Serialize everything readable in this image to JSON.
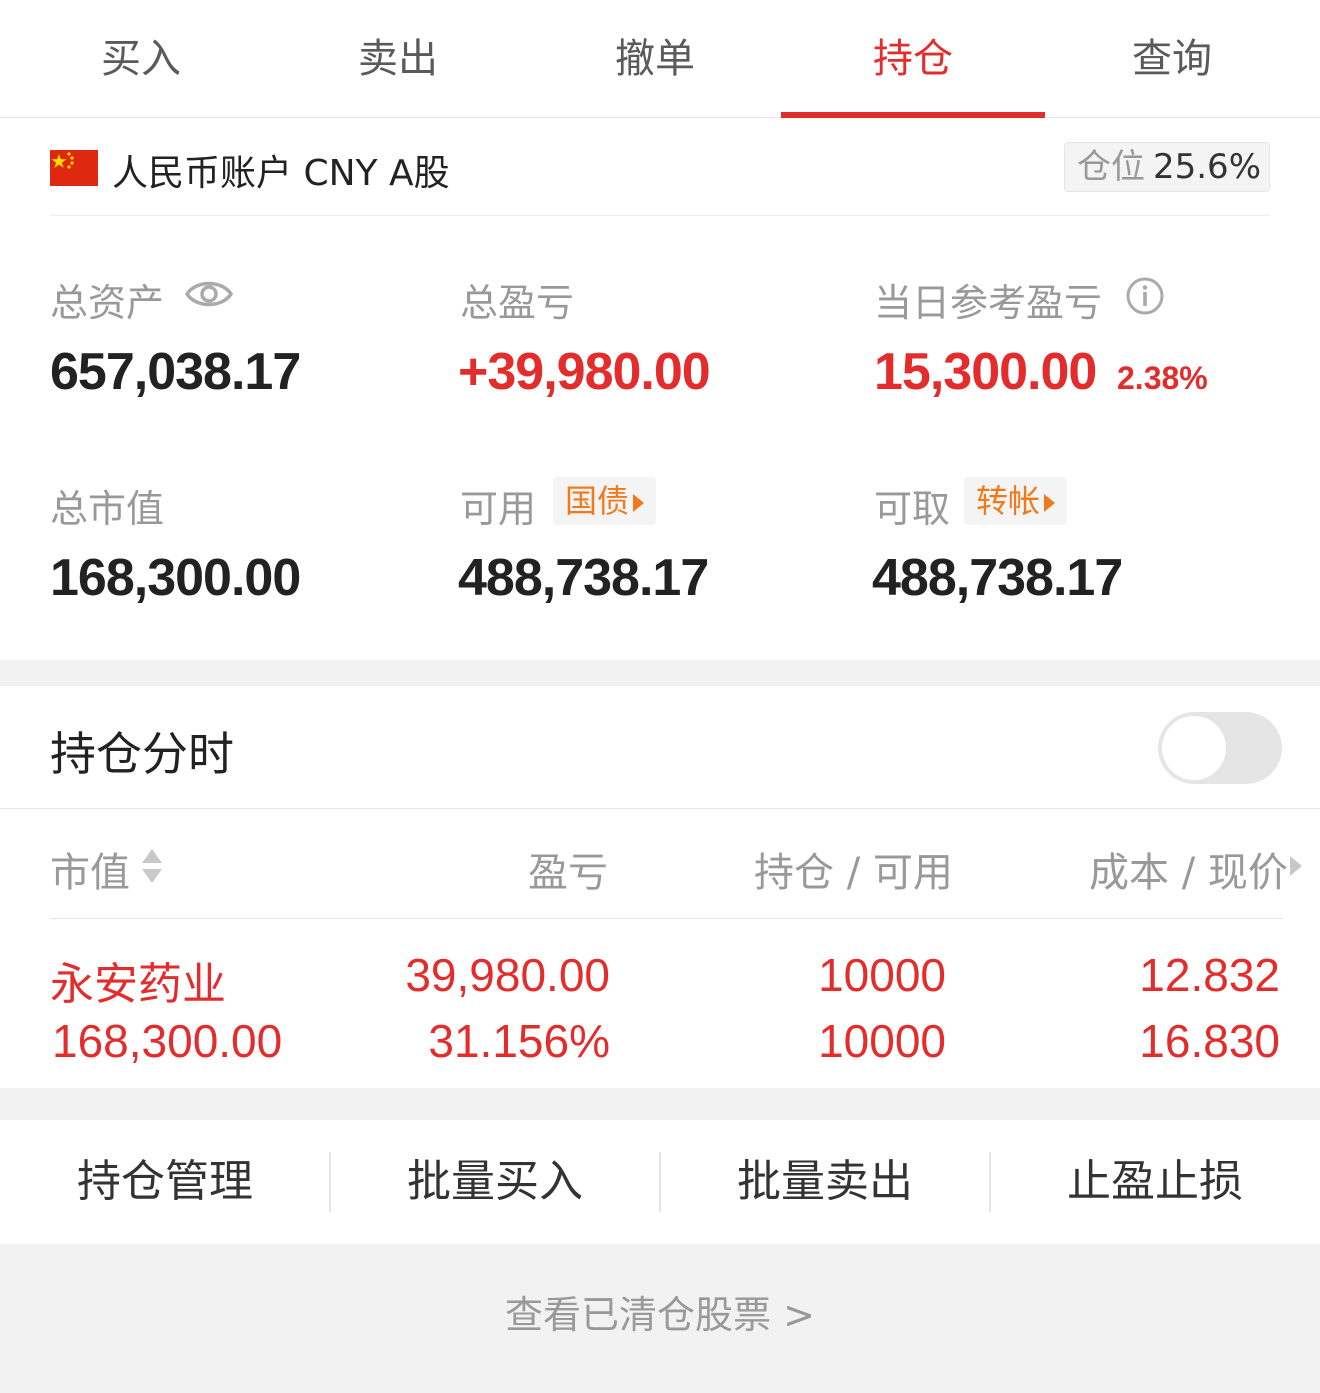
{
  "tabs": [
    {
      "label": "买入",
      "active": false
    },
    {
      "label": "卖出",
      "active": false
    },
    {
      "label": "撤单",
      "active": false
    },
    {
      "label": "持仓",
      "active": true
    },
    {
      "label": "查询",
      "active": false
    }
  ],
  "account": {
    "name": "人民币账户 CNY A股",
    "position_label": "仓位",
    "position_value": "25.6%"
  },
  "stats": {
    "total_assets_label": "总资产",
    "total_assets_value": "657,038.17",
    "total_pnl_label": "总盈亏",
    "total_pnl_value": "+39,980.00",
    "daily_pnl_label": "当日参考盈亏",
    "daily_pnl_value": "15,300.00",
    "daily_pnl_pct": "2.38%",
    "market_value_label": "总市值",
    "market_value_value": "168,300.00",
    "available_label": "可用",
    "available_pill": "国债",
    "available_value": "488,738.17",
    "withdrawable_label": "可取",
    "withdrawable_pill": "转帐",
    "withdrawable_value": "488,738.17"
  },
  "holdings_timeshare": {
    "title": "持仓分时",
    "enabled": false
  },
  "table": {
    "headers": [
      "市值",
      "盈亏",
      "持仓 / 可用",
      "成本 / 现价"
    ],
    "rows": [
      {
        "name": "永安药业",
        "market_value": "168,300.00",
        "pnl": "39,980.00",
        "pnl_pct": "31.156%",
        "holding": "10000",
        "available": "10000",
        "cost": "12.832",
        "price": "16.830"
      }
    ]
  },
  "actions": [
    "持仓管理",
    "批量买入",
    "批量卖出",
    "止盈止损"
  ],
  "footer_link": "查看已清仓股票 >",
  "colors": {
    "accent_red": "#e32c2c",
    "pill_orange": "#f07a1a",
    "muted_text": "#999999"
  }
}
